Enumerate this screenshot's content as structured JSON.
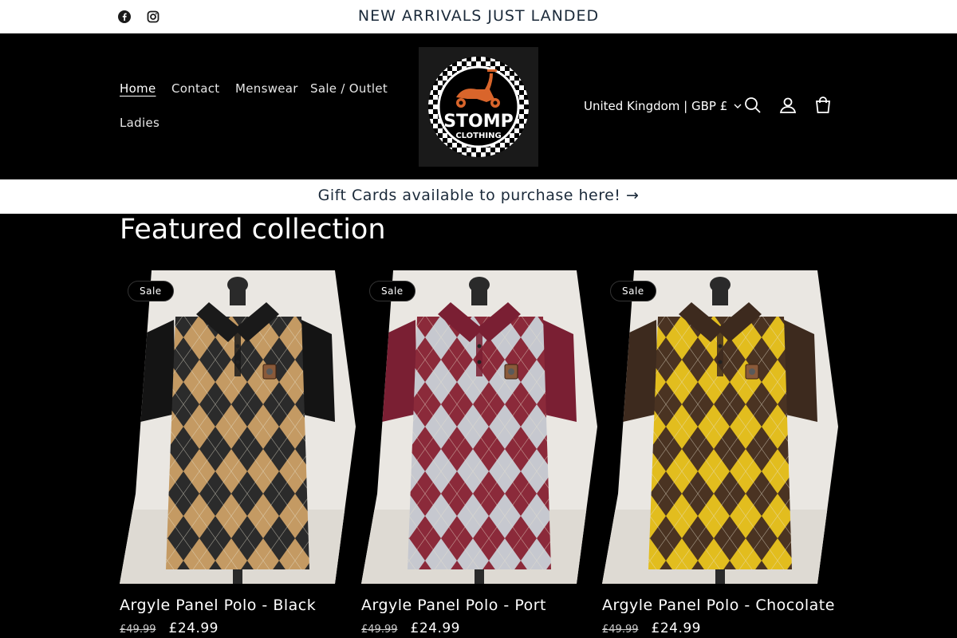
{
  "topbar": {
    "announcement": "NEW ARRIVALS JUST LANDED",
    "social": [
      "facebook-icon",
      "instagram-icon"
    ]
  },
  "nav": {
    "items": [
      {
        "label": "Home",
        "active": true
      },
      {
        "label": "Contact"
      },
      {
        "label": "Menswear"
      },
      {
        "label": "Sale / Outlet"
      },
      {
        "label": "Ladies"
      }
    ]
  },
  "logo": {
    "line1": "STOMP",
    "line2": "CLOTHING"
  },
  "header": {
    "country": "United Kingdom | GBP £",
    "icons": [
      "search-icon",
      "account-icon",
      "cart-icon"
    ]
  },
  "gift": {
    "text": "Gift Cards available to purchase here! →"
  },
  "featured": {
    "title": "Featured collection",
    "products": [
      {
        "badge": "Sale",
        "title": "Argyle Panel Polo - Black",
        "old_price": "£49.99",
        "price": "£24.99",
        "colors": {
          "a": "#c49a63",
          "b": "#2b2b2b",
          "sleeve": "#141414",
          "collar": "#1a1a1a"
        }
      },
      {
        "badge": "Sale",
        "title": "Argyle Panel Polo - Port",
        "old_price": "£49.99",
        "price": "£24.99",
        "colors": {
          "a": "#c6c8cf",
          "b": "#8b2a3a",
          "sleeve": "#7a1f33",
          "collar": "#7a1f33"
        }
      },
      {
        "badge": "Sale",
        "title": "Argyle Panel Polo - Chocolate",
        "old_price": "£49.99",
        "price": "£24.99",
        "colors": {
          "a": "#e2bd1e",
          "b": "#4a3322",
          "sleeve": "#3d2a1e",
          "collar": "#3d2a1e"
        }
      }
    ]
  },
  "colors": {
    "background": "#000000",
    "bar": "#ffffff",
    "bar_text": "#1b2a3a"
  }
}
